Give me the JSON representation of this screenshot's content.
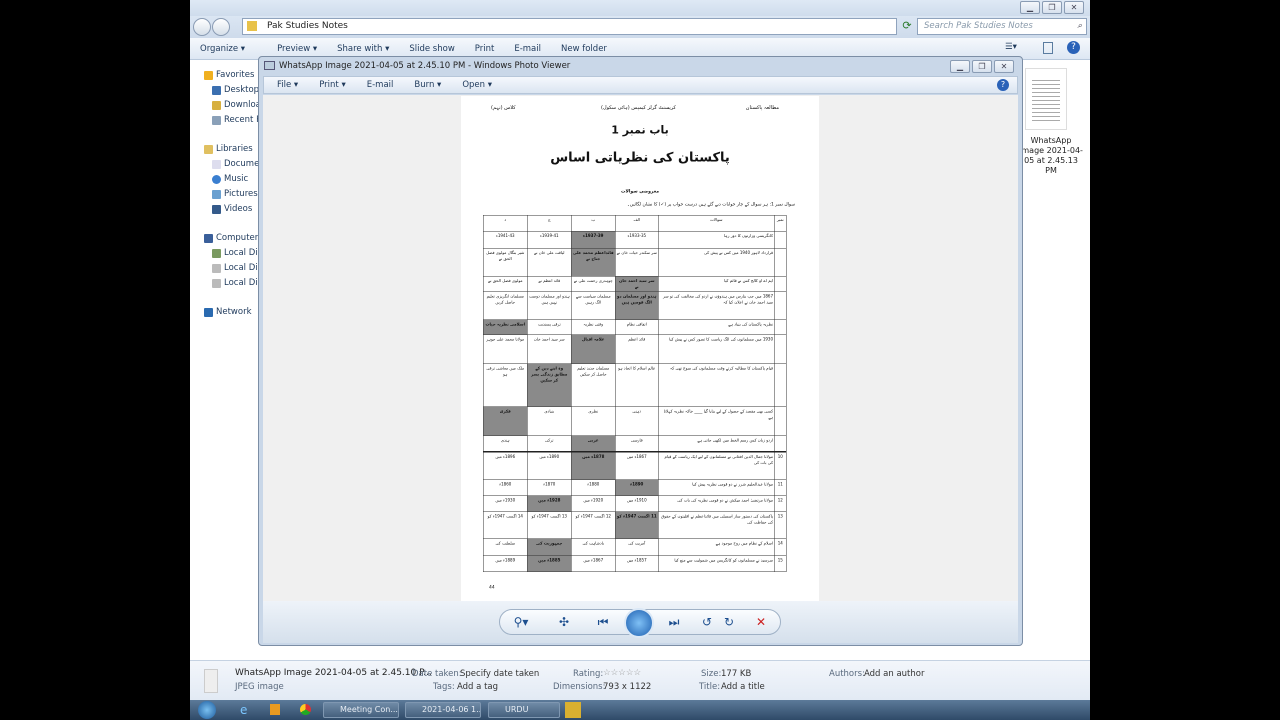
{
  "explorer": {
    "address": "Pak Studies Notes",
    "search_placeholder": "Search Pak Studies Notes",
    "toolbar": [
      "Organize ▾",
      "Preview ▾",
      "Share with ▾",
      "Slide show",
      "Print",
      "E-mail",
      "New folder"
    ],
    "nav": {
      "favorites": "Favorites",
      "desktop": "Desktop",
      "downloads": "Downloads",
      "recent": "Recent Places",
      "libraries": "Libraries",
      "documents": "Documents",
      "music": "Music",
      "pictures": "Pictures",
      "videos": "Videos",
      "computer": "Computer",
      "local1": "Local Disk",
      "local2": "Local Disk",
      "local3": "Local Disk",
      "network": "Network"
    },
    "thumb_label": "WhatsApp Image 2021-04-05 at 2.45.13 PM",
    "details": {
      "name": "WhatsApp Image 2021-04-05 at 2.45.10 P...",
      "type": "JPEG image",
      "date_label": "Date taken:",
      "date_value": "Specify date taken",
      "tags_label": "Tags:",
      "tags_value": "Add a tag",
      "rating_label": "Rating:",
      "rating_stars": "☆☆☆☆☆",
      "dims_label": "Dimensions:",
      "dims_value": "793 x 1122",
      "size_label": "Size:",
      "size_value": "177 KB",
      "title_label": "Title:",
      "title_value": "Add a title",
      "authors_label": "Authors:",
      "authors_value": "Add an author"
    }
  },
  "viewer": {
    "title": "WhatsApp Image 2021-04-05 at 2.45.10 PM - Windows Photo Viewer",
    "menu": [
      "File ▾",
      "Print ▾",
      "E-mail",
      "Burn ▾",
      "Open ▾"
    ]
  },
  "doc": {
    "subject": "مطالعہ پاکستان",
    "school": "کریسنٹ گرلز کیمپس (ہائی سکول)",
    "class": "کلاس (نہم)",
    "chapter": "باب نمبر 1",
    "title": "پاکستان کی نظریاتی اساس",
    "section": "معروضی سوالات",
    "instruction": "سوال نمبر 1: ہر سوال کے چار جوابات دیے گئے ہیں درست جواب پر (✓) کا نشان لگائیں۔",
    "page": "44",
    "headers": [
      "نمبر",
      "سوالات",
      "الف",
      "ب",
      "ج",
      "د"
    ],
    "rows": [
      {
        "n": "",
        "q": "کانگریسی وزارتوں کا دور رہا",
        "o": [
          "1933-35ء",
          "1937-39ء",
          "1939-41ء",
          "1941-43ء"
        ],
        "a": 1
      },
      {
        "n": "",
        "q": "قرارداد لاہور 1940 میں کس نے پیش کی",
        "o": [
          "سر سکندر حیات خان نے",
          "قائداعظم محمد علی جناح نے",
          "لیاقت علی خان نے",
          "شیر بنگال مولوی فضل الحق نے"
        ],
        "a": 1
      },
      {
        "n": "",
        "q": "ایم اے او کالج کس نے قائم کیا",
        "o": [
          "سر سید احمد خان نے",
          "چوہدری رحمت علی نے",
          "قائد اعظم نے",
          "مولوی فضل الحق نے"
        ],
        "a": 0
      },
      {
        "n": "",
        "q": "1867 میں جب بنارس میں ہندوؤں نے اردو کی مخالفت کی تو سر سید احمد خان نے اعلان کیا کہ",
        "o": [
          "ہندو اور مسلمان دو الگ قومیں ہیں",
          "مسلمان سیاست سے الگ رہیں",
          "ہندو اور مسلمان دوست نہیں ہیں",
          "مسلمان انگریزی تعلیم حاصل کریں"
        ],
        "a": 0
      },
      {
        "n": "",
        "q": "نظریہ پاکستان کی بنیاد ہے",
        "o": [
          "اتفاقی نظام",
          "وقتی نظریہ",
          "ترقی پسندیت",
          "اسلامی نظریہ حیات"
        ],
        "a": 3
      },
      {
        "n": "",
        "q": "1930 میں مسلمانوں کی الگ ریاست کا تصور کس نے پیش کیا",
        "o": [
          "قائد اعظم",
          "علامہ اقبال",
          "سر سید احمد خان",
          "مولانا محمد علی جوہر"
        ],
        "a": 1
      },
      {
        "n": "",
        "q": "قیام پاکستان کا مطالبہ کرتے وقت مسلمانوں کی سوچ تھی کہ",
        "o": [
          "عالم اسلام کا اتحاد ہو",
          "مسلمان جدید تعلیم حاصل کر سکیں",
          "وہ اپنے دین کے مطابق زندگی بسر کر سکیں",
          "ملک میں معاشی ترقی ہو"
        ],
        "a": 2
      },
      {
        "n": "",
        "q": "کسی بھی مقصد کے حصول کے لیے بنایا گیا ____ خاکہ نظریہ کہلاتا ہے",
        "o": [
          "ذہنی",
          "نظری",
          "بنیادی",
          "فکری"
        ],
        "a": 3
      },
      {
        "n": "",
        "q": "اردو زبان کس رسم الخط میں لکھی جاتی ہے",
        "o": [
          "فارسی",
          "عربی",
          "ترکی",
          "ہندی"
        ],
        "a": 1
      },
      {
        "n": "10",
        "q": "مولانا جمال الدین افغانی نے مسلمانوں کے لیے ایک ریاست کے قیام کی بات کی",
        "o": [
          "1867ء میں",
          "1878ء میں",
          "1890ء میں",
          "1896ء میں"
        ],
        "a": 1
      },
      {
        "n": "11",
        "q": "مولانا عبدالحلیم شرر نے دو قومی نظریہ پیش کیا",
        "o": [
          "1890ء",
          "1880ء",
          "1870ء",
          "1860ء"
        ],
        "a": 0
      },
      {
        "n": "12",
        "q": "مولانا مرتضیٰ احمد میکش نے دو قومی نظریہ کی بات کی",
        "o": [
          "1910ء میں",
          "1920ء میں",
          "1928ء میں",
          "1930ء میں"
        ],
        "a": 2
      },
      {
        "n": "13",
        "q": "پاکستان کی دستور ساز اسمبلی میں قائداعظم نے اقلیتوں کے حقوق کی حفاظت کی",
        "o": [
          "11 اگست 1947ء کو",
          "12 اگست 1947ء کو",
          "13 اگست 1947ء کو",
          "14 اگست 1947ء کو"
        ],
        "a": 0
      },
      {
        "n": "14",
        "q": "اسلام کے نظام میں روح موجود ہے",
        "o": [
          "آمریت کی",
          "بادشاہت کی",
          "جمہوریت کی",
          "سلطنت کی"
        ],
        "a": 2
      },
      {
        "n": "15",
        "q": "سرسید نے مسلمانوں کو کانگریس میں شمولیت سے منع کیا",
        "o": [
          "1857ء میں",
          "1867ء میں",
          "1885ء میں",
          "1889ء میں"
        ],
        "a": 2
      }
    ]
  },
  "taskbar": {
    "tasks": [
      "Meeting Con...",
      "2021-04-06 1...",
      "URDU"
    ]
  }
}
